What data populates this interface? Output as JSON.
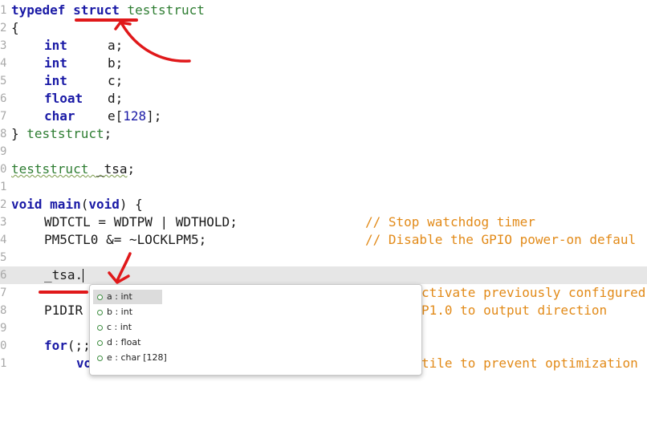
{
  "gutter_numbers": [
    "1",
    "2",
    "3",
    "4",
    "5",
    "6",
    "7",
    "8",
    "9",
    "0",
    "1",
    "2",
    "3",
    "4",
    "5",
    "6",
    "7",
    "8",
    "9",
    "0",
    "1"
  ],
  "code": {
    "l1_kw": "typedef",
    "l1_struct": "struct",
    "l1_name": "teststruct",
    "l2": "{",
    "l3_type": "int",
    "l3_var": "a;",
    "l4_type": "int",
    "l4_var": "b;",
    "l5_type": "int",
    "l5_var": "c;",
    "l6_type": "float",
    "l6_var": "d;",
    "l7_type": "char",
    "l7_var": "e[",
    "l7_num": "128",
    "l7_end": "];",
    "l8_brace": "}",
    "l8_name": "teststruct",
    "l8_semi": ";",
    "l10_type": "teststruct",
    "l10_var": "_tsa",
    "l10_semi": ";",
    "l12_void": "void",
    "l12_main": "main",
    "l12_paren_open": "(",
    "l12_void2": "void",
    "l12_rest": ") {",
    "l13_code": "WDTCTL = WDTPW | WDTHOLD;",
    "l13_comment": "// Stop watchdog timer",
    "l14_code": "PM5CTL0 &= ~LOCKLPM5;",
    "l14_comment": "// Disable the GPIO power-on defaul",
    "l16_code": "_tsa.",
    "l17_comment": "ctivate previously configured",
    "l18_code": "P1DIR",
    "l18_comment": "P1.0 to output direction",
    "l20_for": "for",
    "l20_rest": "(;;",
    "l21_code": "vo",
    "l21_comment": "tile to prevent optimization"
  },
  "autocomplete": {
    "items": [
      {
        "label": "a : int"
      },
      {
        "label": "b : int"
      },
      {
        "label": "c : int"
      },
      {
        "label": "d : float"
      },
      {
        "label": "e : char [128]"
      }
    ],
    "selected_index": 0
  },
  "colors": {
    "keyword": "#1a1aa6",
    "type_name": "#2e7d32",
    "comment": "#e28a18",
    "annotation": "#e0181a",
    "current_line": "#e6e6e6"
  }
}
